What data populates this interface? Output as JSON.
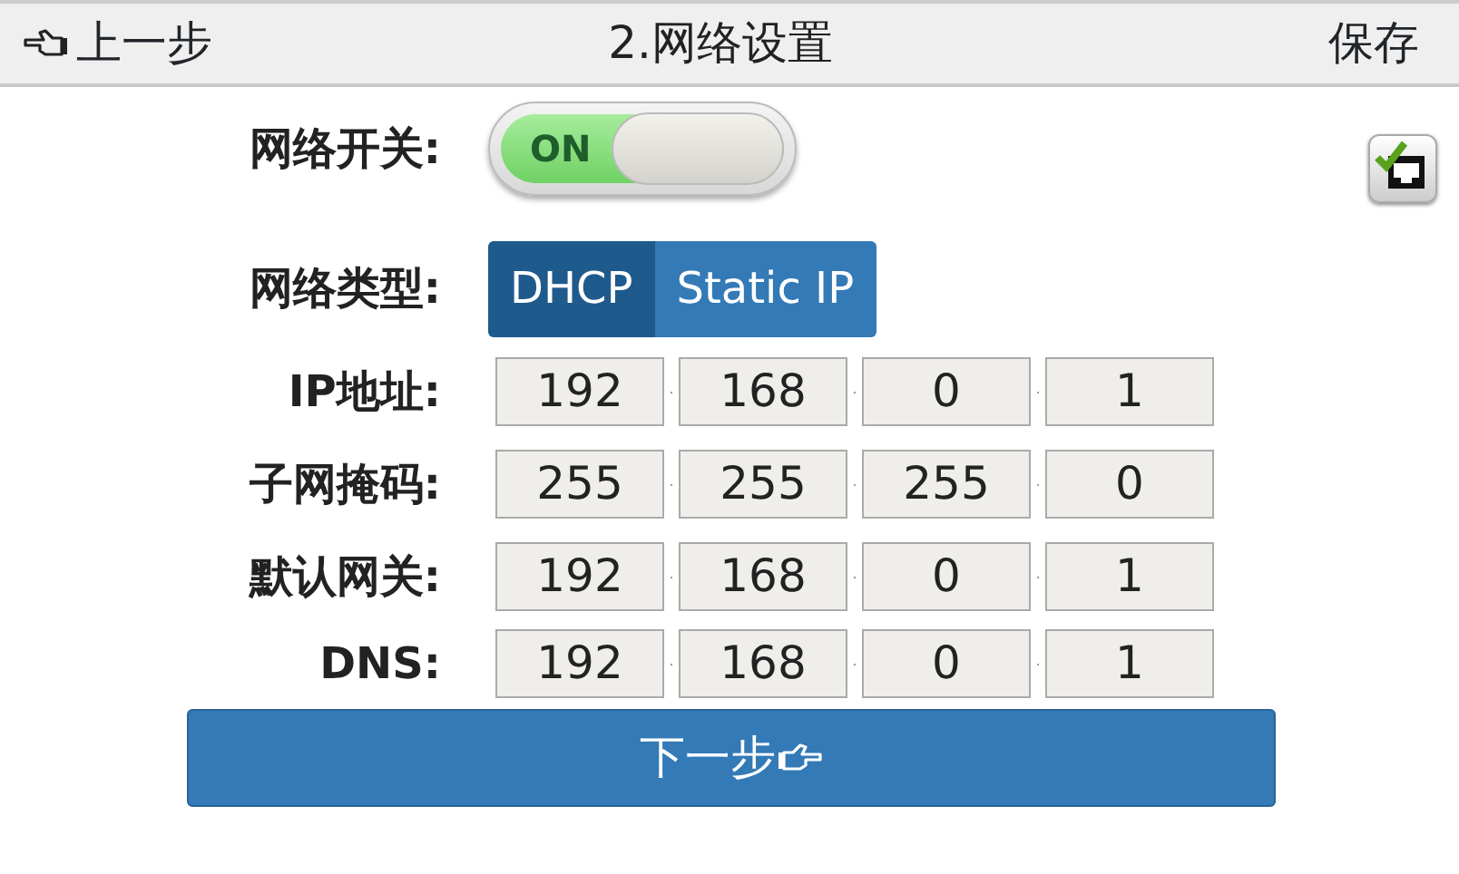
{
  "header": {
    "back": "上一步",
    "title": "2.网络设置",
    "save": "保存"
  },
  "network_switch": {
    "label": "网络开关:",
    "on": true,
    "on_text": "ON"
  },
  "network_type": {
    "label": "网络类型:",
    "options": [
      {
        "label": "DHCP",
        "selected": true
      },
      {
        "label": "Static IP",
        "selected": false
      }
    ]
  },
  "address_rows": [
    {
      "label": "IP地址:",
      "octets": [
        "192",
        "168",
        "0",
        "1"
      ]
    },
    {
      "label": "子网掩码:",
      "octets": [
        "255",
        "255",
        "255",
        "0"
      ]
    },
    {
      "label": "默认网关:",
      "octets": [
        "192",
        "168",
        "0",
        "1"
      ]
    },
    {
      "label": "DNS:",
      "octets": [
        "192",
        "168",
        "0",
        "1"
      ]
    }
  ],
  "separator": ".",
  "next_button": "下一步"
}
